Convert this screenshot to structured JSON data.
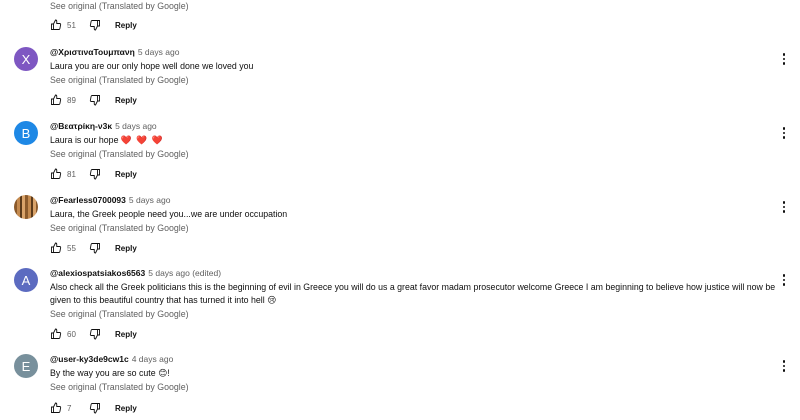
{
  "top_partial": {
    "see_original": "See original (Translated by Google)",
    "likes": "51",
    "reply_label": "Reply"
  },
  "comments": [
    {
      "avatar_letter": "X",
      "avatar_color": "#7e57c2",
      "author": "@ΧριστιναΤουμπανη",
      "meta": "5 days ago",
      "text": "Laura you are our only hope well done we loved you",
      "see_original": "See original (Translated by Google)",
      "likes": "89",
      "reply_label": "Reply"
    },
    {
      "avatar_letter": "B",
      "avatar_color": "#1e88e5",
      "author": "@Βεατρίκη-ν3κ",
      "meta": "5 days ago",
      "text": "Laura is our hope",
      "emoji": "❤️ ❤️ ❤️",
      "see_original": "See original (Translated by Google)",
      "likes": "81",
      "reply_label": "Reply"
    },
    {
      "avatar_letter": "",
      "avatar_color": "#8b5a2b",
      "author": "@Fearless0700093",
      "meta": "5 days ago",
      "text": "Laura, the Greek people need you...we are under occupation",
      "see_original": "See original (Translated by Google)",
      "likes": "55",
      "reply_label": "Reply"
    },
    {
      "avatar_letter": "A",
      "avatar_color": "#5c6bc0",
      "author": "@alexiospatsiakos6563",
      "meta": "5 days ago (edited)",
      "text": "Also check all the Greek politicians this is the beginning of evil in Greece you will do us a great favor madam prosecutor welcome Greece I am beginning to believe how justice will now be given to this beautiful country that has turned it into hell 😢",
      "see_original": "See original (Translated by Google)",
      "likes": "60",
      "reply_label": "Reply"
    },
    {
      "avatar_letter": "E",
      "avatar_color": "#78909c",
      "author": "@user-ky3de9cw1c",
      "meta": "4 days ago",
      "text": "By the way you are so cute 😊!",
      "see_original": "See original (Translated by Google)",
      "likes": "7",
      "reply_label": "Reply"
    }
  ],
  "icons": {
    "like": "thumbs-up-icon",
    "dislike": "thumbs-down-icon",
    "more": "more-vert-icon"
  }
}
